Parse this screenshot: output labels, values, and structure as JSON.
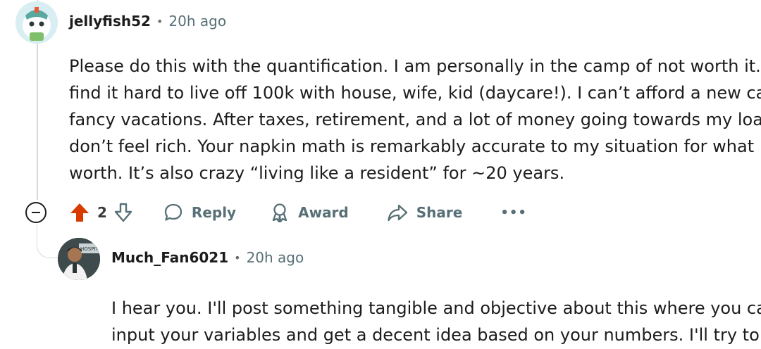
{
  "comment": {
    "username": "jellyfish52",
    "separator": "•",
    "time": "20h ago",
    "body_lines": [
      "Please do this with the quantification. I am personally in the camp of not worth it. I",
      "find it hard to live off 100k with house, wife, kid (daycare!). I can’t afford a new car or",
      "fancy vacations. After taxes, retirement, and a lot of money going towards my loans, I",
      "don’t feel rich. Your napkin math is remarkably accurate to my situation for what it’s",
      "worth. It’s also crazy “living like a resident” for ~20 years."
    ],
    "actions": {
      "upvote_count": "2",
      "reply_label": "Reply",
      "award_label": "Award",
      "share_label": "Share",
      "more_label": "•••"
    }
  },
  "reply": {
    "username": "Much_Fan6021",
    "separator": "•",
    "time": "20h ago",
    "body_lines": [
      "I hear you. I'll post something tangible and objective about this where you can",
      "input your variables and get a decent idea based on your numbers. I'll try to wo"
    ]
  },
  "colors": {
    "upvote_active": "#d93a00",
    "meta_gray": "#576f76",
    "thread_line": "#d7dadc"
  },
  "icons": {
    "collapse": "minus-circle-icon",
    "upvote": "arrow-up-filled-icon",
    "downvote": "arrow-down-outline-icon",
    "reply": "speech-bubble-icon",
    "award": "award-ribbon-icon",
    "share": "share-arrow-icon",
    "more": "ellipsis-icon"
  }
}
